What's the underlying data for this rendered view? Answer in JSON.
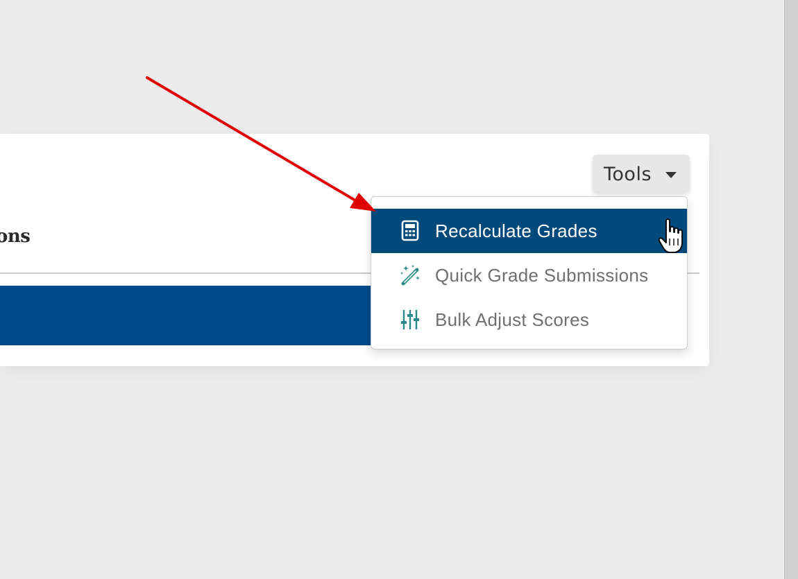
{
  "panel": {
    "heading_fragment": "ons"
  },
  "tools": {
    "label": "Tools"
  },
  "menu": {
    "items": [
      {
        "label": "Recalculate Grades",
        "icon": "calculator-icon",
        "active": true
      },
      {
        "label": "Quick Grade Submissions",
        "icon": "magic-wand-icon",
        "active": false
      },
      {
        "label": "Bulk Adjust Scores",
        "icon": "sliders-icon",
        "active": false
      }
    ]
  },
  "colors": {
    "background": "#ececec",
    "menu_active": "#00497b",
    "blue_bar": "#014a8c",
    "icon_teal": "#2a8a8a",
    "arrow": "#e00000"
  }
}
